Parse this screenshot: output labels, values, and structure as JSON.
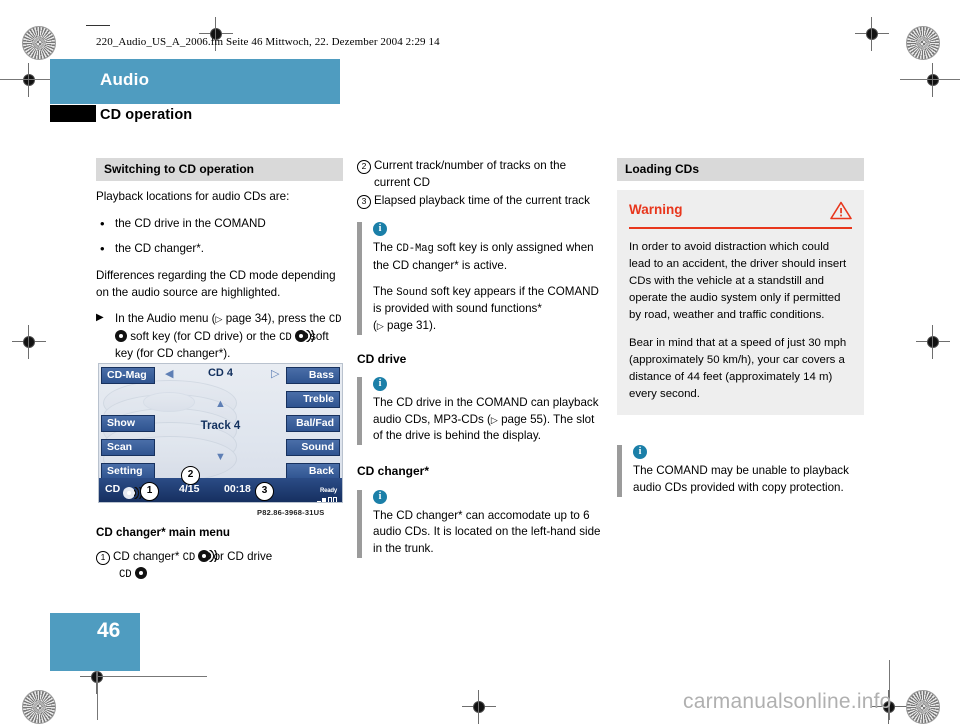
{
  "print_header": {
    "filename_line": "220_Audio_US_A_2006.fm  Seite 46  Mittwoch, 22. Dezember 2004  2:29 14"
  },
  "header": {
    "chapter": "Audio",
    "section": "CD operation",
    "accent_color": "#4f9cc0"
  },
  "page": {
    "number": "46",
    "watermark": "carmanualsonline.info"
  },
  "column1": {
    "heading": "Switching to CD operation",
    "intro": "Playback locations for audio CDs are:",
    "bullets": [
      "the CD drive in the COMAND",
      "the CD changer*."
    ],
    "paragraph": "Differences regarding the CD mode depending on the audio source are highlighted.",
    "step": {
      "prefix": "In the Audio menu (",
      "ref": "page 34",
      "middle": "), press the",
      "key1": "CD",
      "mid2": "soft key (for CD drive) or the",
      "key2": "CD",
      "suffix": "soft key (for CD changer*)."
    },
    "figure_caption": "P82.86-3968-31US",
    "figure_title": "CD changer* main menu",
    "legend": {
      "number": "1",
      "text_a": "CD changer*",
      "key_a": "CD",
      "text_b": "or CD drive",
      "key_b": "CD"
    }
  },
  "comand_display": {
    "soft_keys_left": [
      "CD-Mag",
      "Show",
      "Scan",
      "Setting"
    ],
    "soft_keys_right": [
      "Bass",
      "Treble",
      "Bal/Fad",
      "Sound",
      "Back"
    ],
    "title": "CD 4",
    "track_label": "Track 4",
    "status": {
      "source": "CD",
      "track": "4/15",
      "time": "00:18",
      "ready": "Ready"
    },
    "callouts": [
      "1",
      "2",
      "3"
    ],
    "arrow_left": "◀",
    "arrow_right": "▷",
    "arrow_up": "▲",
    "arrow_down": "▼"
  },
  "column2": {
    "legend_items": [
      {
        "number": "2",
        "text": "Current track/number of tracks on the current CD"
      },
      {
        "number": "3",
        "text": "Elapsed playback time of the current track"
      }
    ],
    "note1": {
      "p1_a": "The",
      "p1_key": "CD-Mag",
      "p1_b": "soft key is only assigned when the CD changer* is active.",
      "p2_a": "The",
      "p2_key": "Sound",
      "p2_b": "soft key appears if the COMAND is provided with sound functions* (",
      "p2_ref": "page 31",
      "p2_c": ")."
    },
    "cd_drive_heading": "CD drive",
    "cd_drive_note": {
      "a": "The CD drive in the COMAND can playback audio CDs, MP3-CDs (",
      "ref": "page 55",
      "b": "). The slot of the drive is behind the display."
    },
    "cd_changer_heading": "CD changer*",
    "cd_changer_note": "The CD changer* can accomodate up to 6 audio CDs. It is located on the left-hand side in the trunk."
  },
  "column3": {
    "heading": "Loading CDs",
    "warning": {
      "label": "Warning",
      "color": "#e8361c",
      "paragraphs": [
        "In order to avoid distraction which could lead to an accident, the driver should insert CDs with the vehicle at a standstill and operate the audio system only if permitted by road, weather and traffic conditions.",
        "Bear in mind that at a speed of just 30 mph (approximately 50 km/h), your car covers a distance of 44 feet (approximately 14 m) every second."
      ]
    },
    "note": "The COMAND may be unable to playback audio CDs provided with copy protection."
  },
  "icons": {
    "info": "i",
    "warning_triangle": "warning-triangle-icon"
  }
}
